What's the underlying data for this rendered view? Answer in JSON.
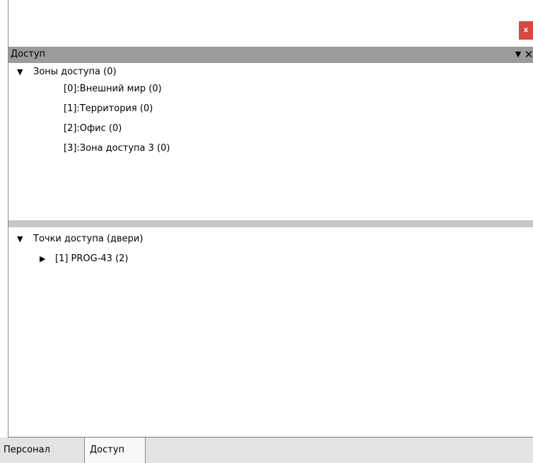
{
  "window": {
    "close_label": "x"
  },
  "panel": {
    "title": "Доступ",
    "dropdown_icon": "▼",
    "close_icon": "✕"
  },
  "zones": {
    "arrow": "▼",
    "header": "Зоны доступа (0)",
    "items": [
      {
        "label": "[0]:Внешний мир (0)"
      },
      {
        "label": "[1]:Территория (0)"
      },
      {
        "label": "[2]:Офис (0)"
      },
      {
        "label": "[3]:Зона доступа 3 (0)"
      }
    ]
  },
  "points": {
    "arrow": "▼",
    "header": "Точки доступа (двери)",
    "items": [
      {
        "arrow": "▶",
        "label": "[1] PROG-43 (2)"
      }
    ]
  },
  "tabs": [
    {
      "label": "Персонал",
      "active": false
    },
    {
      "label": "Доступ",
      "active": true
    }
  ],
  "colors": {
    "close_button": "#d9473f",
    "panel_header": "#9b9b9b",
    "splitter": "#c7c7c7",
    "tabbar": "#e3e3e3"
  }
}
